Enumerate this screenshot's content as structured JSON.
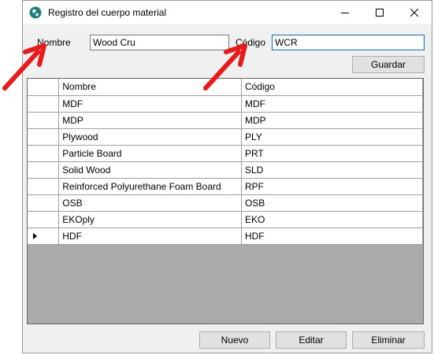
{
  "window": {
    "title": "Registro del cuerpo material",
    "icon": "app-globe-icon",
    "accent": "#0078d7"
  },
  "form": {
    "nombre_label": "Nombre",
    "nombre_value": "Wood Cru",
    "codigo_label": "Código",
    "codigo_value": "WCR",
    "save_label": "Guardar"
  },
  "table": {
    "columns": [
      "Nombre",
      "Código"
    ],
    "rows": [
      {
        "nombre": "MDF",
        "codigo": "MDF"
      },
      {
        "nombre": "MDP",
        "codigo": "MDP"
      },
      {
        "nombre": "Plywood",
        "codigo": "PLY"
      },
      {
        "nombre": "Particle Board",
        "codigo": "PRT"
      },
      {
        "nombre": "Solid Wood",
        "codigo": "SLD"
      },
      {
        "nombre": "Reinforced Polyurethane Foam Board",
        "codigo": "RPF"
      },
      {
        "nombre": "OSB",
        "codigo": "OSB"
      },
      {
        "nombre": "EKOply",
        "codigo": "EKO"
      },
      {
        "nombre": "HDF",
        "codigo": "HDF"
      }
    ],
    "current_row_indicator": "row-pointer-icon"
  },
  "footer": {
    "new_label": "Nuevo",
    "edit_label": "Editar",
    "delete_label": "Eliminar"
  },
  "annotations": {
    "arrow_color": "#e81a1a"
  }
}
